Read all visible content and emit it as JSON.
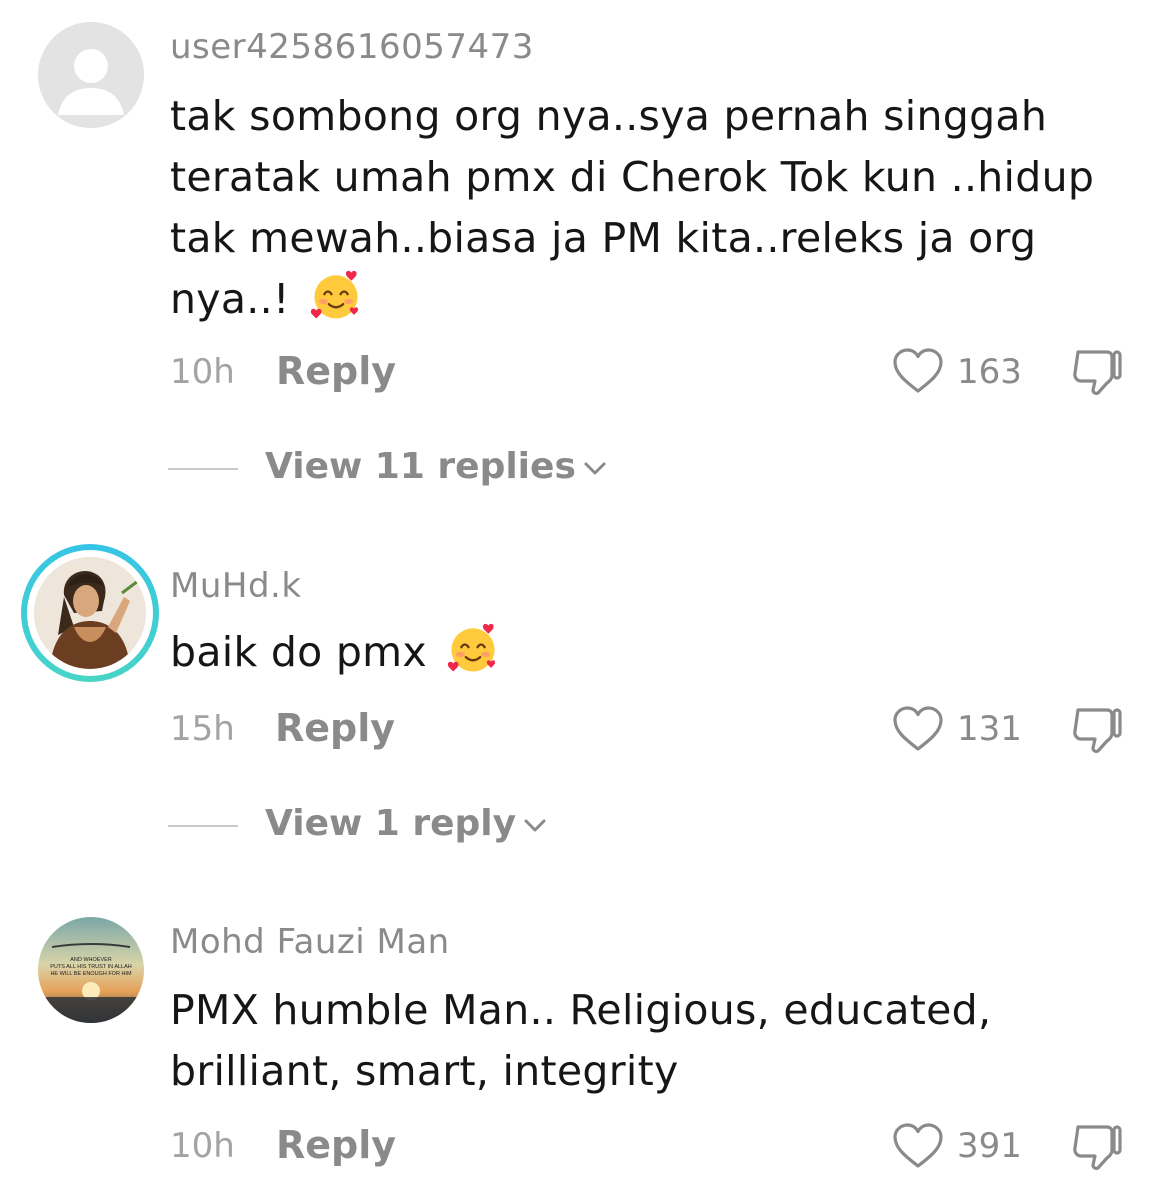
{
  "comments": [
    {
      "username": "user4258616057473",
      "text": "tak sombong org nya..sya pernah singgah teratak umah pmx di Cherok Tok kun ..hidup tak mewah..biasa ja PM kita..releks ja org nya..!",
      "emoji": "smiling-face-with-hearts",
      "time": "10h",
      "reply_label": "Reply",
      "likes": "163",
      "view_replies": "View 11 replies"
    },
    {
      "username": "MuHd.k",
      "text": "baik do pmx",
      "emoji": "smiling-face-with-hearts",
      "time": "15h",
      "reply_label": "Reply",
      "likes": "131",
      "view_replies": "View 1 reply"
    },
    {
      "username": "Mohd Fauzi Man",
      "text": "PMX humble Man.. Religious, educated, brilliant, smart, integrity",
      "time": "10h",
      "reply_label": "Reply",
      "likes": "391",
      "avatar_caption": [
        "AND WHOEVER",
        "PUTS ALL HIS TRUST IN ALLAH",
        "HE WILL BE ENOUGH FOR HIM"
      ]
    }
  ],
  "colors": {
    "username": "#8a8a8a",
    "text": "#161616",
    "meta": "#a3a3a3",
    "story_ring": "#35c3e8"
  }
}
